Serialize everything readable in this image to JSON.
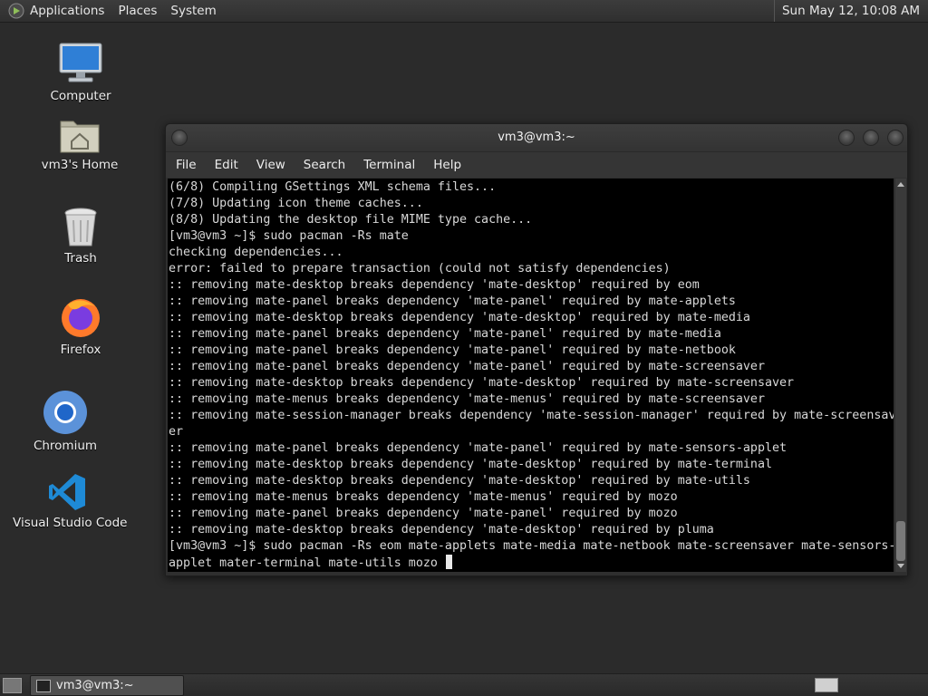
{
  "top_panel": {
    "menus": [
      "Applications",
      "Places",
      "System"
    ],
    "clock": "Sun May 12, 10:08 AM"
  },
  "desktop": {
    "icons": [
      {
        "label": "Computer",
        "icon": "computer-icon"
      },
      {
        "label": "vm3's Home",
        "icon": "home-folder-icon"
      },
      {
        "label": "Trash",
        "icon": "trash-icon"
      },
      {
        "label": "Firefox",
        "icon": "firefox-icon"
      },
      {
        "label": "Chromium",
        "icon": "chromium-icon"
      },
      {
        "label": "Visual Studio Code",
        "icon": "vscode-icon"
      }
    ]
  },
  "terminal": {
    "title": "vm3@vm3:~",
    "menu": [
      "File",
      "Edit",
      "View",
      "Search",
      "Terminal",
      "Help"
    ],
    "lines": [
      "(6/8) Compiling GSettings XML schema files...",
      "(7/8) Updating icon theme caches...",
      "(8/8) Updating the desktop file MIME type cache...",
      "[vm3@vm3 ~]$ sudo pacman -Rs mate",
      "checking dependencies...",
      "error: failed to prepare transaction (could not satisfy dependencies)",
      ":: removing mate-desktop breaks dependency 'mate-desktop' required by eom",
      ":: removing mate-panel breaks dependency 'mate-panel' required by mate-applets",
      ":: removing mate-desktop breaks dependency 'mate-desktop' required by mate-media",
      ":: removing mate-panel breaks dependency 'mate-panel' required by mate-media",
      ":: removing mate-panel breaks dependency 'mate-panel' required by mate-netbook",
      ":: removing mate-panel breaks dependency 'mate-panel' required by mate-screensaver",
      ":: removing mate-desktop breaks dependency 'mate-desktop' required by mate-screensaver",
      ":: removing mate-menus breaks dependency 'mate-menus' required by mate-screensaver",
      ":: removing mate-session-manager breaks dependency 'mate-session-manager' required by mate-screensav",
      "er",
      ":: removing mate-panel breaks dependency 'mate-panel' required by mate-sensors-applet",
      ":: removing mate-desktop breaks dependency 'mate-desktop' required by mate-terminal",
      ":: removing mate-desktop breaks dependency 'mate-desktop' required by mate-utils",
      ":: removing mate-menus breaks dependency 'mate-menus' required by mozo",
      ":: removing mate-panel breaks dependency 'mate-panel' required by mozo",
      ":: removing mate-desktop breaks dependency 'mate-desktop' required by pluma",
      "[vm3@vm3 ~]$ sudo pacman -Rs eom mate-applets mate-media mate-netbook mate-screensaver mate-sensors-",
      "applet mater-terminal mate-utils mozo "
    ]
  },
  "bottom_panel": {
    "task_label": "vm3@vm3:~"
  }
}
